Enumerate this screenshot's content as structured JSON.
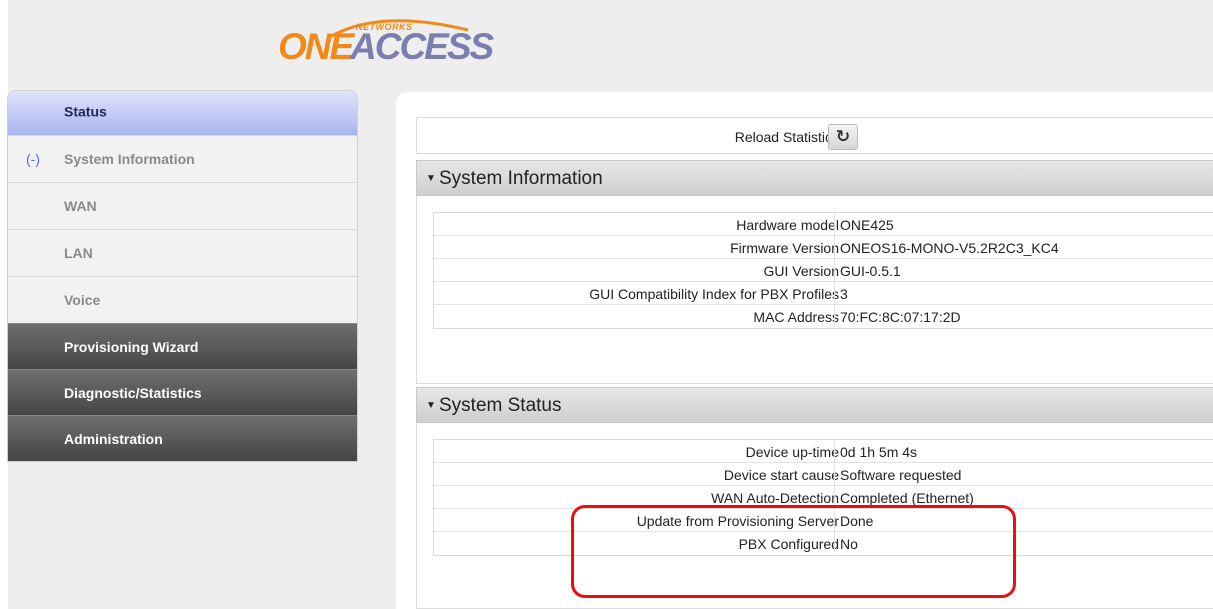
{
  "logo": {
    "one": "ONE",
    "access": "ACCESS",
    "networks": "NETWORKS"
  },
  "sidebar": {
    "items": [
      {
        "label": "Status"
      },
      {
        "label": "System Information",
        "marker": "(-)"
      },
      {
        "label": "WAN"
      },
      {
        "label": "LAN"
      },
      {
        "label": "Voice"
      },
      {
        "label": "Provisioning Wizard"
      },
      {
        "label": "Diagnostic/Statistics"
      },
      {
        "label": "Administration"
      }
    ]
  },
  "main": {
    "reload_label": "Reload Statistics",
    "reload_icon": "refresh-icon",
    "system_information": {
      "title": "System Information",
      "rows": [
        {
          "key": "Hardware model",
          "value": "ONE425"
        },
        {
          "key": "Firmware Version",
          "value": "ONEOS16-MONO-V5.2R2C3_KC4"
        },
        {
          "key": "GUI Version",
          "value": "GUI-0.5.1"
        },
        {
          "key": "GUI Compatibility Index for PBX Profiles",
          "value": "3"
        },
        {
          "key": "MAC Address",
          "value": "70:FC:8C:07:17:2D"
        }
      ]
    },
    "system_status": {
      "title": "System Status",
      "rows": [
        {
          "key": "Device up-time",
          "value": "0d 1h 5m 4s"
        },
        {
          "key": "Device start cause",
          "value": "Software requested"
        },
        {
          "key": "WAN Auto-Detection",
          "value": "Completed (Ethernet)"
        },
        {
          "key": "Update from Provisioning Server",
          "value": "Done"
        },
        {
          "key": "PBX Configured",
          "value": "No"
        }
      ]
    }
  },
  "colors": {
    "highlight": "#e51010",
    "logo_orange": "#f08a1c",
    "logo_purple": "#7a7fb0"
  }
}
